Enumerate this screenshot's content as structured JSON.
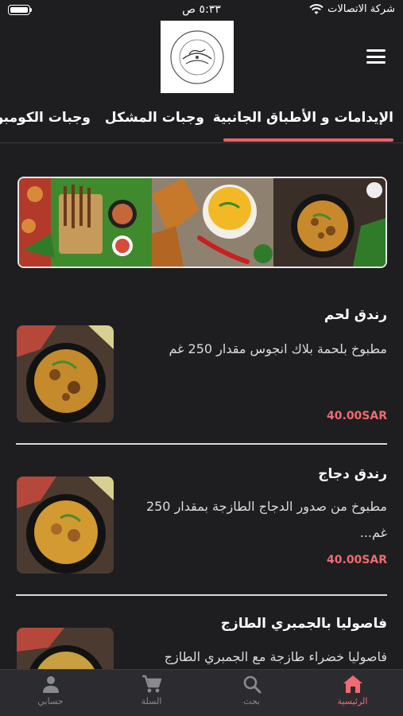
{
  "status_bar": {
    "time": "٥:٣٣ ص",
    "carrier": "شركة الاتصالات"
  },
  "header": {
    "logo_text": "CAFE NA NOON"
  },
  "tabs": [
    {
      "label": "الإيدامات و الأطباق الجانبية",
      "active": true
    },
    {
      "label": "وجبات المشكل",
      "active": false
    },
    {
      "label": "وجبات الكومبو",
      "active": false
    }
  ],
  "items": [
    {
      "title": "رندق لحم",
      "description": "مطبوخ بلحمة بلاك انجوس مقدار 250 غم",
      "price": "40.00SAR"
    },
    {
      "title": "رندق دجاج",
      "description": "مطبوخ من صدور الدجاج الطازجة بمقدار 250 غم...",
      "price": "40.00SAR"
    },
    {
      "title": "فاصوليا بالجمبري الطازج",
      "description": "فاصوليا خضراء طازجة مع الجمبري الطازج",
      "price": ""
    }
  ],
  "bottom_nav": [
    {
      "label": "الرئيسية",
      "icon": "home-icon",
      "active": true
    },
    {
      "label": "بحث",
      "icon": "search-icon",
      "active": false
    },
    {
      "label": "السلة",
      "icon": "cart-icon",
      "active": false
    },
    {
      "label": "حسابي",
      "icon": "person-icon",
      "active": false
    }
  ],
  "colors": {
    "background": "#1e1e21",
    "accent": "#ef6b6f",
    "nav_background": "#2c2c30"
  }
}
